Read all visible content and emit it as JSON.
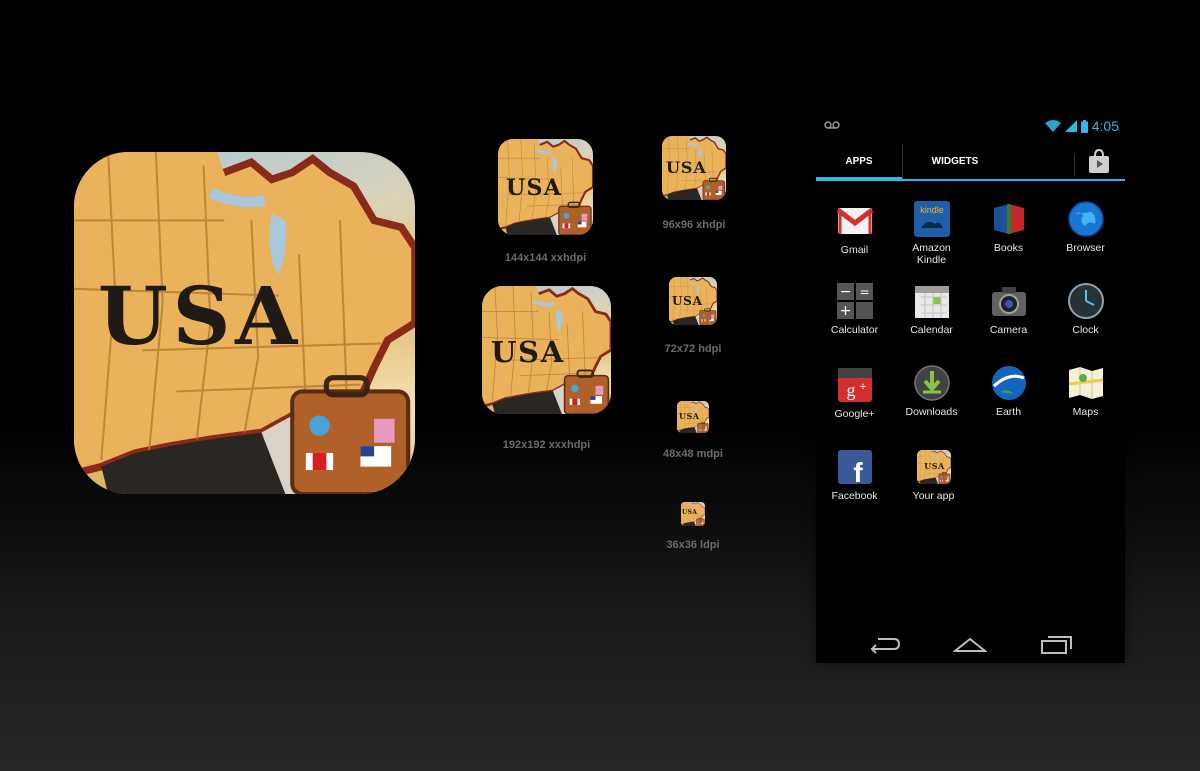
{
  "icons": [
    {
      "label": "144x144 xxhdpi"
    },
    {
      "label": "96x96 xhdpi"
    },
    {
      "label": "192x192 xxxhdpi"
    },
    {
      "label": "72x72 hdpi"
    },
    {
      "label": "48x48 mdpi"
    },
    {
      "label": "36x36 ldpi"
    }
  ],
  "icon_text": "USA",
  "phone": {
    "status": {
      "time": "4:05"
    },
    "tabs": {
      "apps": "APPS",
      "widgets": "WIDGETS"
    },
    "apps": [
      {
        "name": "Gmail",
        "icon": "gmail-icon"
      },
      {
        "name": "Amazon Kindle",
        "icon": "kindle-icon"
      },
      {
        "name": "Books",
        "icon": "books-icon"
      },
      {
        "name": "Browser",
        "icon": "browser-icon"
      },
      {
        "name": "Calculator",
        "icon": "calculator-icon"
      },
      {
        "name": "Calendar",
        "icon": "calendar-icon"
      },
      {
        "name": "Camera",
        "icon": "camera-icon"
      },
      {
        "name": "Clock",
        "icon": "clock-icon"
      },
      {
        "name": "Google+",
        "icon": "google-plus-icon"
      },
      {
        "name": "Downloads",
        "icon": "downloads-icon"
      },
      {
        "name": "Earth",
        "icon": "earth-icon"
      },
      {
        "name": "Maps",
        "icon": "maps-icon"
      },
      {
        "name": "Facebook",
        "icon": "facebook-icon"
      },
      {
        "name": "Your app",
        "icon": "usa-app-icon"
      }
    ]
  },
  "colors": {
    "accent": "#33b5e5",
    "background": "#000000"
  }
}
